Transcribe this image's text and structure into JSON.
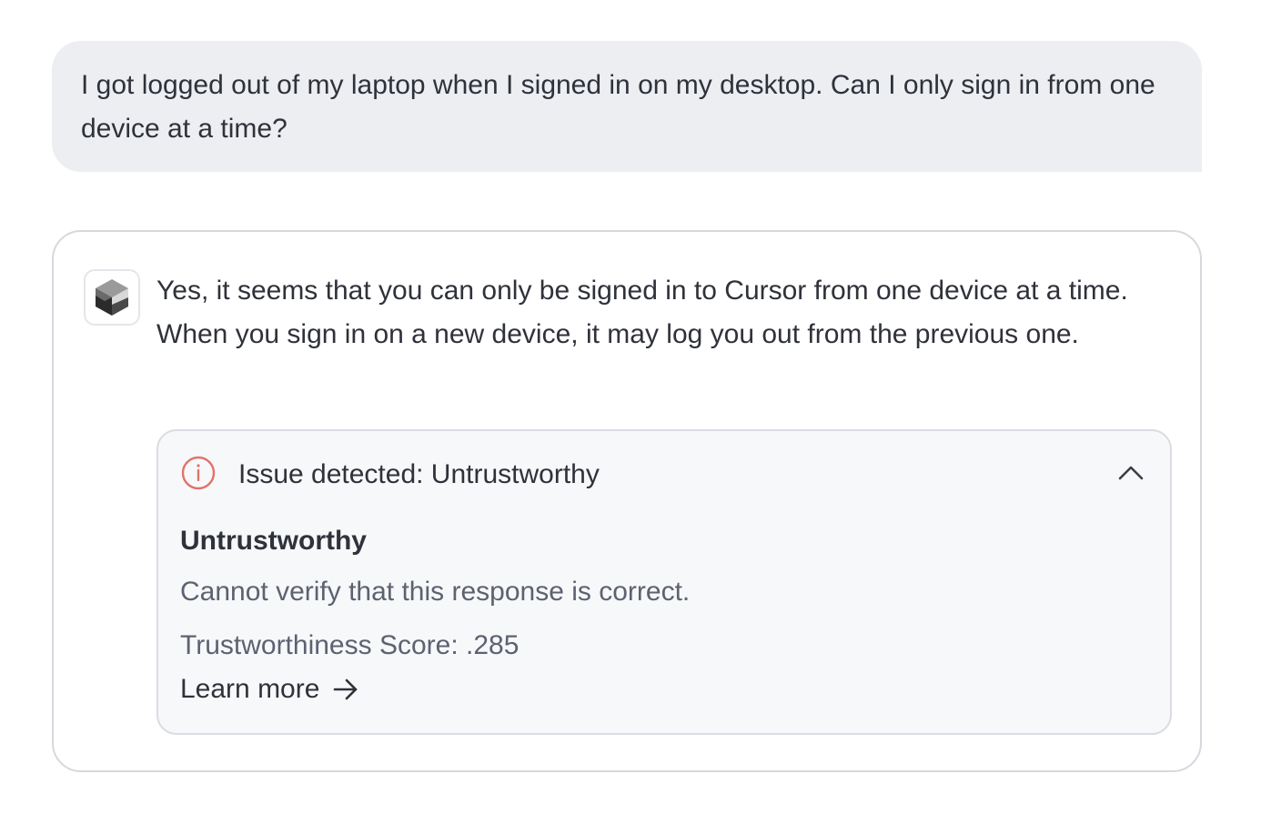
{
  "user_message": {
    "text": "I got logged out of my laptop when I signed in on my desktop. Can I only sign in from one device at a time?"
  },
  "assistant_message": {
    "avatar_icon": "cube-logo-icon",
    "text": "Yes, it seems that you can only be signed in to Cursor from one device at a time. When you sign in on a new device, it may log you out from the previous one."
  },
  "issue": {
    "title": "Issue detected: Untrustworthy",
    "heading": "Untrustworthy",
    "description": "Cannot verify that this response is correct.",
    "score_text": "Trustworthiness Score: .285",
    "learn_more_label": "Learn more",
    "icon": "info-icon",
    "toggle_icon": "chevron-up-icon",
    "alert_color": "#e0736b"
  }
}
